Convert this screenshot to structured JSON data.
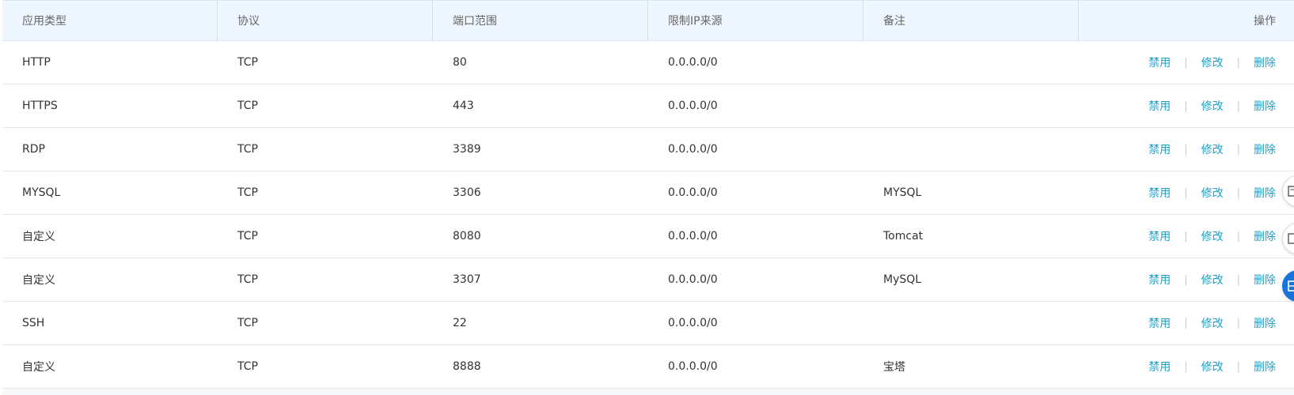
{
  "headers": {
    "app_type": "应用类型",
    "protocol": "协议",
    "port_range": "端口范围",
    "source_ip": "限制IP来源",
    "note": "备注",
    "actions": "操作"
  },
  "action_labels": {
    "disable": "禁用",
    "edit": "修改",
    "delete": "删除",
    "separator": "|"
  },
  "rows": [
    {
      "app_type": "HTTP",
      "protocol": "TCP",
      "port": "80",
      "source": "0.0.0.0/0",
      "note": ""
    },
    {
      "app_type": "HTTPS",
      "protocol": "TCP",
      "port": "443",
      "source": "0.0.0.0/0",
      "note": ""
    },
    {
      "app_type": "RDP",
      "protocol": "TCP",
      "port": "3389",
      "source": "0.0.0.0/0",
      "note": ""
    },
    {
      "app_type": "MYSQL",
      "protocol": "TCP",
      "port": "3306",
      "source": "0.0.0.0/0",
      "note": "MYSQL"
    },
    {
      "app_type": "自定义",
      "protocol": "TCP",
      "port": "8080",
      "source": "0.0.0.0/0",
      "note": "Tomcat"
    },
    {
      "app_type": "自定义",
      "protocol": "TCP",
      "port": "3307",
      "source": "0.0.0.0/0",
      "note": "MySQL"
    },
    {
      "app_type": "SSH",
      "protocol": "TCP",
      "port": "22",
      "source": "0.0.0.0/0",
      "note": ""
    },
    {
      "app_type": "自定义",
      "protocol": "TCP",
      "port": "8888",
      "source": "0.0.0.0/0",
      "note": "宝塔"
    }
  ],
  "floating_buttons": [
    {
      "icon": "document-icon",
      "variant": "white"
    },
    {
      "icon": "document-icon",
      "variant": "white"
    },
    {
      "icon": "chat-icon",
      "variant": "blue"
    }
  ],
  "colors": {
    "link": "#20a0c8",
    "header_bg": "#eef6ff",
    "floating_blue": "#1a73d9"
  }
}
